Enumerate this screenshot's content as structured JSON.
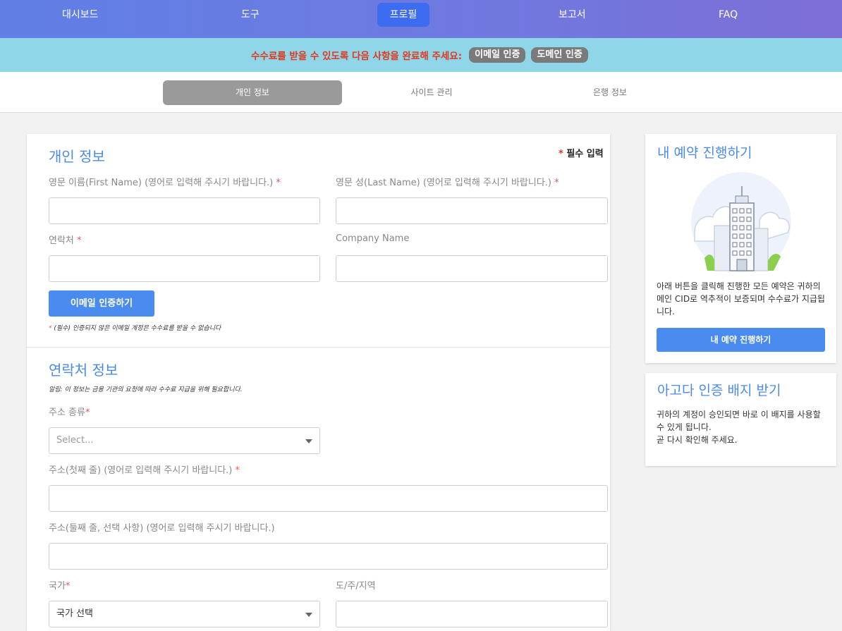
{
  "topnav": {
    "items": [
      {
        "label": "대시보드",
        "active": false
      },
      {
        "label": "도구",
        "active": false
      },
      {
        "label": "프로필",
        "active": true
      },
      {
        "label": "보고서",
        "active": false
      },
      {
        "label": "FAQ",
        "active": false
      }
    ]
  },
  "notice": {
    "message": "수수료를 받을 수 있도록 다음 사항을 완료해 주세요:",
    "badges": [
      "이메일 인증",
      "도메인 인증"
    ]
  },
  "subtabs": [
    {
      "label": "개인 정보",
      "active": true
    },
    {
      "label": "사이트 관리",
      "active": false
    },
    {
      "label": "은행 정보",
      "active": false
    }
  ],
  "personal": {
    "title": "개인 정보",
    "required_note": "필수 입력",
    "first_name_label": "영문 이름(First Name) (영어로 입력해 주시기 바랍니다.)",
    "last_name_label": "영문 성(Last Name) (영어로 입력해 주시기 바랍니다.)",
    "contact_label": "연락처",
    "company_label": "Company Name",
    "verify_button": "이메일 인증하기",
    "verify_note": "(필수) 인증되지 않은 이메일 계정은 수수료를 받을 수 없습니다"
  },
  "contact_info": {
    "title": "연락처 정보",
    "note": "알림: 이 정보는 금융 기관의 요청에 따라 수수료 지급을 위해 필요합니다.",
    "address_type_label": "주소 종류",
    "address_type_placeholder": "Select...",
    "address1_label": "주소(첫째 줄) (영어로 입력해 주시기 바랍니다.)",
    "address2_label": "주소(둘째 줄, 선택 사항) (영어로 입력해 주시기 바랍니다.)",
    "country_label": "국가",
    "country_value": "국가 선택",
    "region_label": "도/주/지역"
  },
  "booking_card": {
    "title": "내 예약 진행하기",
    "text": "아래 버튼을 클릭해 진행한 모든 예약은 귀하의 메인 CID로 역추적이 보증되며 수수료가 지급됩니다.",
    "button": "내 예약 진행하기"
  },
  "badge_card": {
    "title": "아고다 인증 배지 받기",
    "text1": "귀하의 계정이 승인되면 바로 이 배지를 사용할 수 있게 됩니다.",
    "text2": "곧 다시 확인해 주세요."
  },
  "colors": {
    "accent": "#4a8be8",
    "button": "#4a8bf0",
    "notice_bg": "#8fd6e8",
    "notice_text": "#e0381f"
  }
}
